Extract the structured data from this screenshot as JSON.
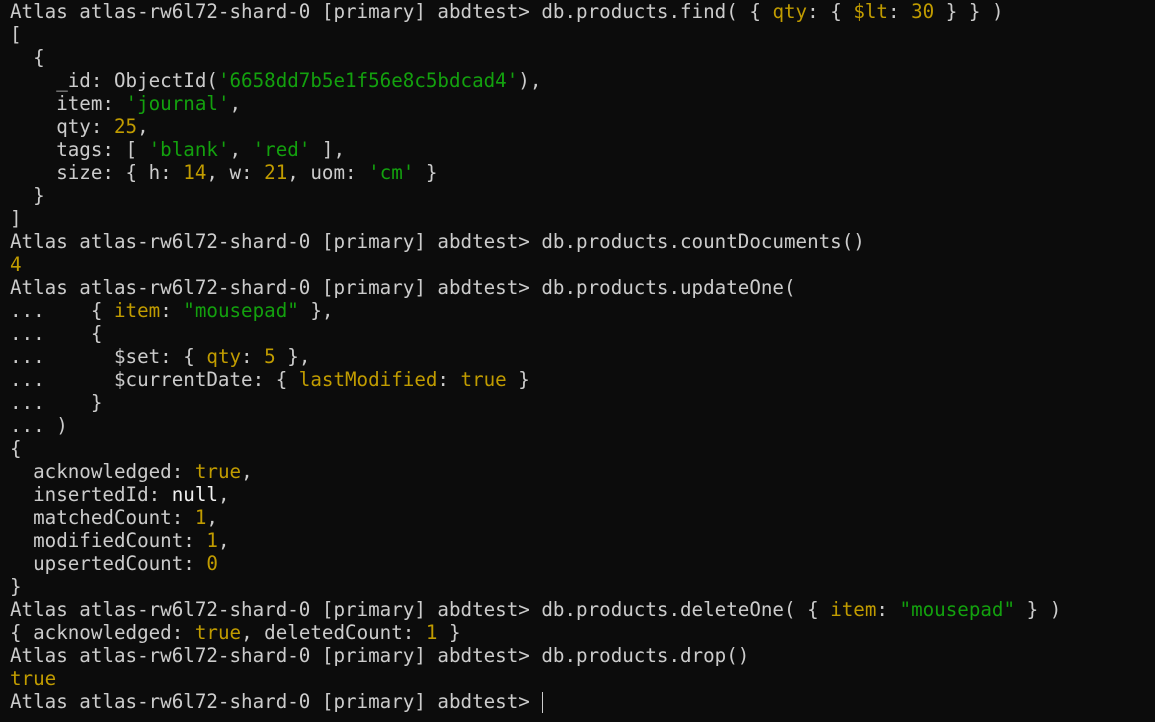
{
  "colors": {
    "background": "#0c0c0c",
    "default": "#cccccc",
    "key": "#c19c00",
    "number": "#c19c00",
    "string": "#13a10e",
    "bright": "#f2f2f2"
  },
  "terminal": {
    "lines": [
      [
        {
          "t": "Atlas atlas-rw6l72-shard-0 [primary] abdtest> db.products.find( { ",
          "c": "default"
        },
        {
          "t": "qty",
          "c": "key"
        },
        {
          "t": ": { ",
          "c": "default"
        },
        {
          "t": "$lt",
          "c": "key"
        },
        {
          "t": ": ",
          "c": "default"
        },
        {
          "t": "30",
          "c": "number"
        },
        {
          "t": " } } )",
          "c": "default"
        }
      ],
      [
        {
          "t": "[",
          "c": "default"
        }
      ],
      [
        {
          "t": "  {",
          "c": "default"
        }
      ],
      [
        {
          "t": "    _id: ObjectId(",
          "c": "default"
        },
        {
          "t": "'6658dd7b5e1f56e8c5bdcad4'",
          "c": "string"
        },
        {
          "t": "),",
          "c": "default"
        }
      ],
      [
        {
          "t": "    item: ",
          "c": "default"
        },
        {
          "t": "'journal'",
          "c": "string"
        },
        {
          "t": ",",
          "c": "default"
        }
      ],
      [
        {
          "t": "    qty: ",
          "c": "default"
        },
        {
          "t": "25",
          "c": "number"
        },
        {
          "t": ",",
          "c": "default"
        }
      ],
      [
        {
          "t": "    tags: [ ",
          "c": "default"
        },
        {
          "t": "'blank'",
          "c": "string"
        },
        {
          "t": ", ",
          "c": "default"
        },
        {
          "t": "'red'",
          "c": "string"
        },
        {
          "t": " ],",
          "c": "default"
        }
      ],
      [
        {
          "t": "    size: { h: ",
          "c": "default"
        },
        {
          "t": "14",
          "c": "number"
        },
        {
          "t": ", w: ",
          "c": "default"
        },
        {
          "t": "21",
          "c": "number"
        },
        {
          "t": ", uom: ",
          "c": "default"
        },
        {
          "t": "'cm'",
          "c": "string"
        },
        {
          "t": " }",
          "c": "default"
        }
      ],
      [
        {
          "t": "  }",
          "c": "default"
        }
      ],
      [
        {
          "t": "]",
          "c": "default"
        }
      ],
      [
        {
          "t": "Atlas atlas-rw6l72-shard-0 [primary] abdtest> db.products.countDocuments()",
          "c": "default"
        }
      ],
      [
        {
          "t": "4",
          "c": "number"
        }
      ],
      [
        {
          "t": "Atlas atlas-rw6l72-shard-0 [primary] abdtest> db.products.updateOne(",
          "c": "default"
        }
      ],
      [
        {
          "t": "...    { ",
          "c": "default"
        },
        {
          "t": "item",
          "c": "key"
        },
        {
          "t": ": ",
          "c": "default"
        },
        {
          "t": "\"mousepad\"",
          "c": "string"
        },
        {
          "t": " },",
          "c": "default"
        }
      ],
      [
        {
          "t": "...    {",
          "c": "default"
        }
      ],
      [
        {
          "t": "...      $set: { ",
          "c": "default"
        },
        {
          "t": "qty",
          "c": "key"
        },
        {
          "t": ": ",
          "c": "default"
        },
        {
          "t": "5",
          "c": "number"
        },
        {
          "t": " },",
          "c": "default"
        }
      ],
      [
        {
          "t": "...      $currentDate: { ",
          "c": "default"
        },
        {
          "t": "lastModified",
          "c": "key"
        },
        {
          "t": ": ",
          "c": "default"
        },
        {
          "t": "true",
          "c": "key"
        },
        {
          "t": " }",
          "c": "default"
        }
      ],
      [
        {
          "t": "...    }",
          "c": "default"
        }
      ],
      [
        {
          "t": "... )",
          "c": "default"
        }
      ],
      [
        {
          "t": "{",
          "c": "default"
        }
      ],
      [
        {
          "t": "  acknowledged: ",
          "c": "default"
        },
        {
          "t": "true",
          "c": "number"
        },
        {
          "t": ",",
          "c": "default"
        }
      ],
      [
        {
          "t": "  insertedId: ",
          "c": "default"
        },
        {
          "t": "null",
          "c": "bright"
        },
        {
          "t": ",",
          "c": "default"
        }
      ],
      [
        {
          "t": "  matchedCount: ",
          "c": "default"
        },
        {
          "t": "1",
          "c": "number"
        },
        {
          "t": ",",
          "c": "default"
        }
      ],
      [
        {
          "t": "  modifiedCount: ",
          "c": "default"
        },
        {
          "t": "1",
          "c": "number"
        },
        {
          "t": ",",
          "c": "default"
        }
      ],
      [
        {
          "t": "  upsertedCount: ",
          "c": "default"
        },
        {
          "t": "0",
          "c": "number"
        }
      ],
      [
        {
          "t": "}",
          "c": "default"
        }
      ],
      [
        {
          "t": "Atlas atlas-rw6l72-shard-0 [primary] abdtest> db.products.deleteOne( { ",
          "c": "default"
        },
        {
          "t": "item",
          "c": "key"
        },
        {
          "t": ": ",
          "c": "default"
        },
        {
          "t": "\"mousepad\"",
          "c": "string"
        },
        {
          "t": " } )",
          "c": "default"
        }
      ],
      [
        {
          "t": "{ acknowledged: ",
          "c": "default"
        },
        {
          "t": "true",
          "c": "number"
        },
        {
          "t": ", deletedCount: ",
          "c": "default"
        },
        {
          "t": "1",
          "c": "number"
        },
        {
          "t": " }",
          "c": "default"
        }
      ],
      [
        {
          "t": "Atlas atlas-rw6l72-shard-0 [primary] abdtest> db.products.drop()",
          "c": "default"
        }
      ],
      [
        {
          "t": "true",
          "c": "number"
        }
      ]
    ],
    "prompt": "Atlas atlas-rw6l72-shard-0 [primary] abdtest> "
  }
}
